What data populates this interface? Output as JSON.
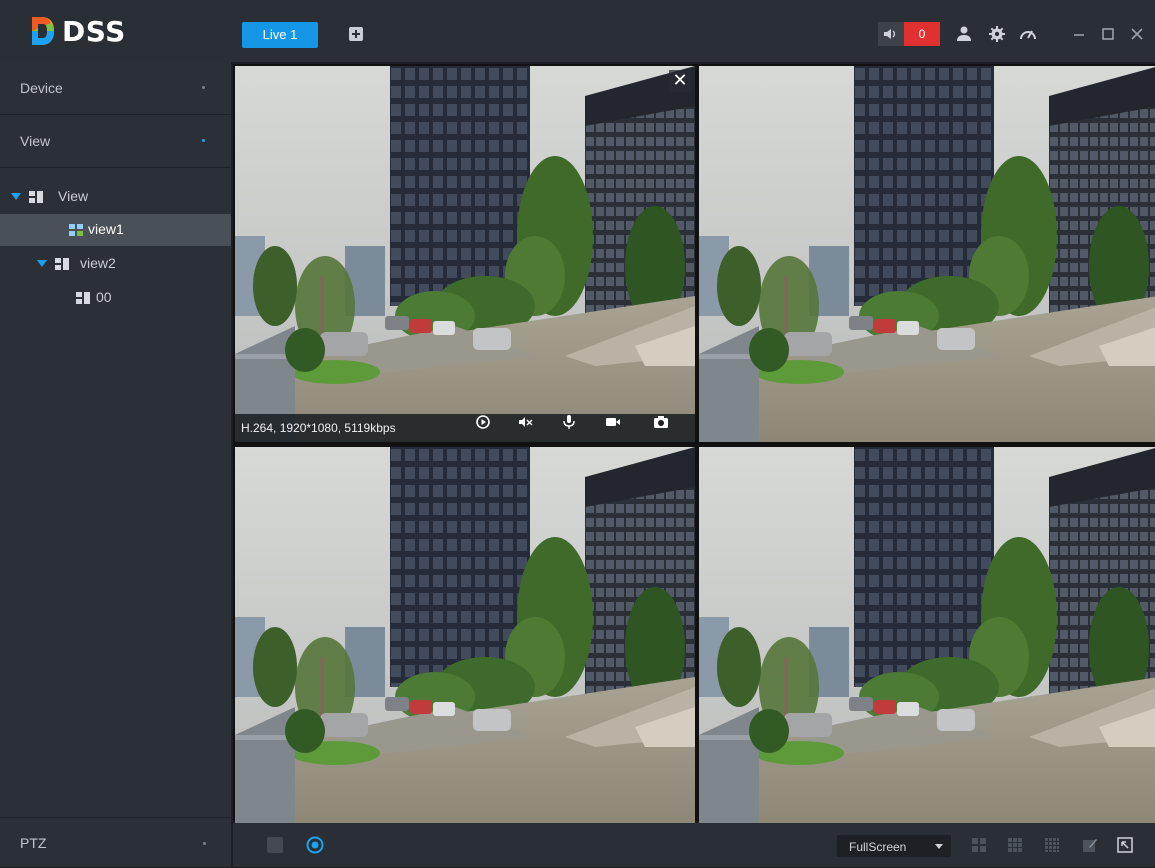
{
  "app": {
    "logo_text": "DSS"
  },
  "tabs": [
    {
      "label": "Live 1",
      "active": true
    }
  ],
  "toolbar": {
    "alarm_count": "0",
    "icons": [
      "speaker-icon",
      "user-icon",
      "gear-icon",
      "speedometer-icon",
      "minimize-icon",
      "maximize-icon",
      "close-icon"
    ]
  },
  "sidebar": {
    "sections": [
      {
        "label": "Device",
        "expanded": false
      },
      {
        "label": "View",
        "expanded": true
      }
    ],
    "tree": [
      {
        "label": "View",
        "level": 0,
        "expanded": true,
        "selected": false
      },
      {
        "label": "view1",
        "level": 1,
        "selected": true
      },
      {
        "label": "view2",
        "level": 1,
        "expanded": true,
        "selected": false
      },
      {
        "label": "00",
        "level": 2,
        "selected": false
      }
    ],
    "ptz_label": "PTZ"
  },
  "video": {
    "close_symbol": "✕",
    "info": "H.264, 1920*1080, 5119kbps",
    "controls": [
      "playback-icon",
      "mute-icon",
      "microphone-icon",
      "record-icon",
      "snapshot-icon"
    ]
  },
  "bottom": {
    "display_mode": "FullScreen",
    "split_icons": [
      "split-4-icon",
      "split-9-icon",
      "split-16-icon",
      "custom-split-icon",
      "fit-window-icon"
    ]
  },
  "colors": {
    "accent": "#1596e6",
    "alarm": "#e0302f",
    "selection": "#3aa6e8"
  }
}
